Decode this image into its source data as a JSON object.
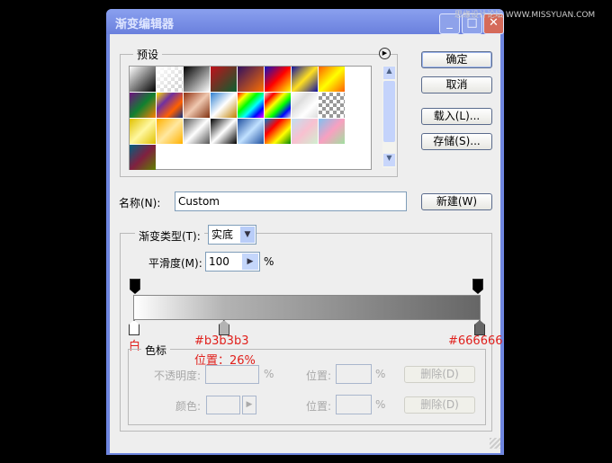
{
  "window": {
    "title": "渐变编辑器",
    "watermark": "思缘设计论坛 WWW.MISSYUAN.COM"
  },
  "buttons": {
    "ok": "确定",
    "cancel": "取消",
    "load": "载入(L)...",
    "save": "存储(S)...",
    "new": "新建(W)"
  },
  "presets": {
    "label": "预设",
    "swatches": [
      "linear-gradient(135deg,#fff,#000)",
      "linear-gradient(135deg,#fff,rgba(255,255,255,0)),repeating-conic-gradient(#ccc 0 25%,#fff 0 50%) 0 0/8px 8px",
      "linear-gradient(135deg,#000,#fff)",
      "linear-gradient(135deg,#c0101a,#0a6030)",
      "linear-gradient(135deg,#301060,#ff7000)",
      "linear-gradient(135deg,#1010c0,#ff0000,#ffff00)",
      "linear-gradient(135deg,#1010a0,#ffe020,#1010a0)",
      "linear-gradient(135deg,#ff6000,#ffff00,#ff6000)",
      "linear-gradient(135deg,#701080,#108030,#ff8000)",
      "linear-gradient(135deg,#ffe000,#7030a0,#ff6000,#103080)",
      "linear-gradient(135deg,#903010,#f0c8b0,#803010)",
      "linear-gradient(135deg,#3080d0,#fff 50%,#c08000)",
      "linear-gradient(135deg,#f00,#ff0,#0f0,#0ff,#00f,#f0f)",
      "linear-gradient(135deg,#ddd,#f00,#ff0,#0f0,#00f,#ddd)",
      "linear-gradient(135deg,#fff,#ddd,#fff,#ddd)",
      "repeating-conic-gradient(#999 0 25%,#fff 0 50%) 0 0/8px 8px",
      "linear-gradient(135deg,#e0c000,#fff8a0,#e0c000)",
      "linear-gradient(135deg,#ffb000,#ffe8a0,#ffb000)",
      "linear-gradient(135deg,#555,#fff,#555)",
      "linear-gradient(135deg,#000,#fff,#000)",
      "linear-gradient(135deg,#2050a0,#c0e0ff,#2050a0)",
      "linear-gradient(135deg,#0080d0,#f00,#ff0,#080)",
      "linear-gradient(135deg,#c0e0f0,#f8c0d0,#d0f0d0)",
      "linear-gradient(135deg,#80c0f0,#f8a0c0,#a0e0a0)",
      "linear-gradient(135deg,#006080,#802040,#608000)"
    ]
  },
  "name": {
    "label": "名称(N):",
    "value": "Custom"
  },
  "gradient_type": {
    "label": "渐变类型(T):",
    "value": "实底"
  },
  "smoothness": {
    "label": "平滑度(M):",
    "value": "100",
    "unit": "%"
  },
  "gradient": {
    "stops": [
      {
        "color": "#ffffff",
        "position": 0
      },
      {
        "color": "#b3b3b3",
        "position": 26
      },
      {
        "color": "#666666",
        "position": 100
      }
    ]
  },
  "annotations": {
    "white": "白",
    "mid": "#b3b3b3",
    "mid_pos": "位置：26%",
    "end": "#666666"
  },
  "color_stops": {
    "label": "色标",
    "opacity_label": "不透明度:",
    "percent": "%",
    "location_label": "位置:",
    "delete": "删除(D)",
    "color_label": "颜色:"
  }
}
